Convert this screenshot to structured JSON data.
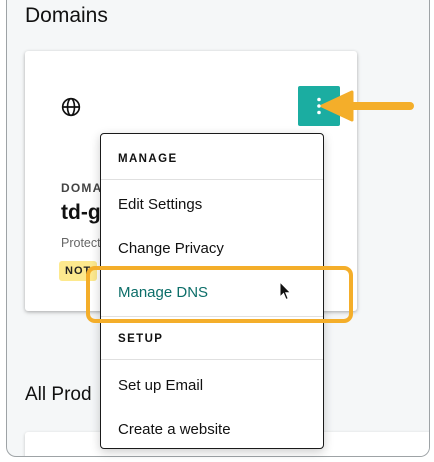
{
  "section": {
    "title": "Domains"
  },
  "domain_card": {
    "icon": "globe-icon",
    "label": "DOMA",
    "name": "td-g",
    "status": "Protect",
    "badge": "NOT",
    "menu_button_icon": "vertical-ellipsis-icon",
    "menu_button_color": "#1bada1"
  },
  "menu": {
    "manage_header": "MANAGE",
    "items_manage": [
      "Edit Settings",
      "Change Privacy",
      "Manage DNS"
    ],
    "setup_header": "SETUP",
    "items_setup": [
      "Set up Email",
      "Create a website"
    ],
    "highlighted_item": "Manage DNS"
  },
  "all_products": {
    "title": "All Prod"
  },
  "annotations": {
    "highlight_color": "#f4ae2a",
    "arrow_icon": "left-arrow-icon",
    "cursor_icon": "mouse-pointer-icon"
  }
}
